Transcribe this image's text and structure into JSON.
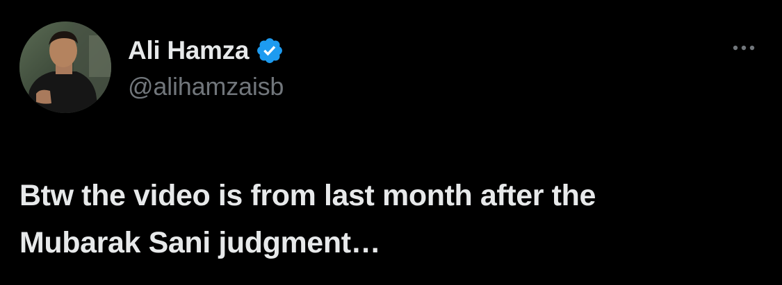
{
  "author": {
    "display_name": "Ali Hamza",
    "handle": "@alihamzaisb",
    "verified": true,
    "verified_icon": "verified-badge-icon",
    "avatar_icon": "profile-photo"
  },
  "menu": {
    "more_icon": "more-horizontal-icon"
  },
  "tweet": {
    "text_lines": [
      "Btw the video is from last month after the",
      "Mubarak Sani judgment…"
    ]
  },
  "colors": {
    "background": "#000000",
    "primary_text": "#e7e9ea",
    "secondary_text": "#71767b",
    "verified_blue": "#1d9bf0"
  }
}
